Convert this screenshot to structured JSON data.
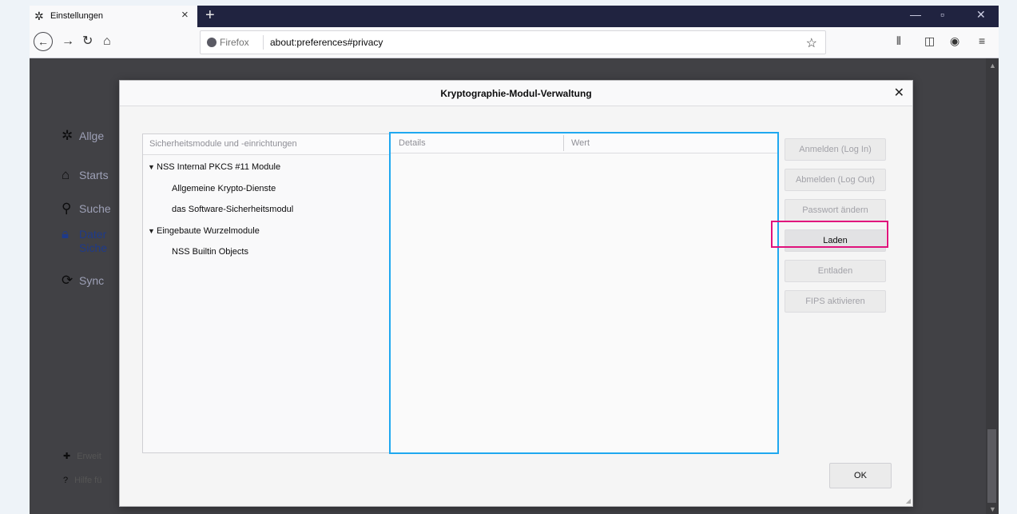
{
  "browser": {
    "tab_title": "Einstellungen",
    "new_tab_symbol": "+",
    "url_identity": "Firefox",
    "url": "about:preferences#privacy",
    "window_controls": [
      "—",
      "▫",
      "✕"
    ]
  },
  "sidebar": {
    "items": [
      {
        "label": "Allge",
        "icon": "gear-icon"
      },
      {
        "label": "Starts",
        "icon": "home-icon"
      },
      {
        "label": "Suche",
        "icon": "search-icon"
      },
      {
        "label": "Dater",
        "label2": "Siche",
        "icon": "lock-icon"
      },
      {
        "label": "Sync",
        "icon": "sync-icon"
      }
    ],
    "footer": [
      {
        "label": "Erweit",
        "icon": "puzzle-icon"
      },
      {
        "label": "Hilfe fü",
        "icon": "help-icon"
      }
    ]
  },
  "dialog": {
    "title": "Kryptographie-Modul-Verwaltung",
    "tree_header": "Sicherheitsmodule und -einrichtungen",
    "tree": [
      {
        "label": "NSS Internal PKCS #11 Module",
        "expanded": true,
        "level": 0
      },
      {
        "label": "Allgemeine Krypto-Dienste",
        "level": 1
      },
      {
        "label": "das Software-Sicherheitsmodul",
        "level": 1
      },
      {
        "label": "Eingebaute Wurzelmodule",
        "expanded": true,
        "level": 0
      },
      {
        "label": "NSS Builtin Objects",
        "level": 1
      }
    ],
    "details_columns": [
      "Details",
      "Wert"
    ],
    "buttons": [
      {
        "label": "Anmelden (Log In)",
        "enabled": false
      },
      {
        "label": "Abmelden (Log Out)",
        "enabled": false
      },
      {
        "label": "Passwort ändern",
        "enabled": false
      },
      {
        "label": "Laden",
        "enabled": true,
        "highlighted": true
      },
      {
        "label": "Entladen",
        "enabled": false
      },
      {
        "label": "FIPS aktivieren",
        "enabled": false
      }
    ],
    "ok_label": "OK"
  },
  "colors": {
    "details_border": "#1fa8f0",
    "highlight": "#e0127c",
    "tabstrip": "#202340"
  }
}
